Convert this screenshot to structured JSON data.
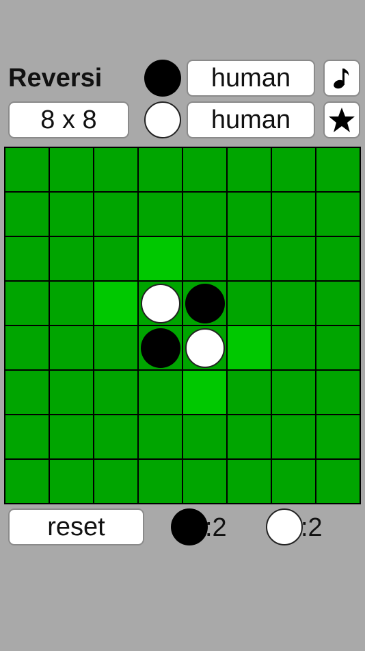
{
  "app": {
    "title": "Reversi"
  },
  "size_button": {
    "label": "8 x 8"
  },
  "players": {
    "black": {
      "label": "human"
    },
    "white": {
      "label": "human"
    }
  },
  "icons": {
    "music": "music-note-icon",
    "favorite": "star-icon"
  },
  "colors": {
    "background": "#a9a9a9",
    "board": "#00a500",
    "legal_move_highlight": "#00c800",
    "grid_lines": "#000000"
  },
  "board": {
    "size": 8,
    "cells": [
      [
        "",
        "",
        "",
        "",
        "",
        "",
        "",
        ""
      ],
      [
        "",
        "",
        "",
        "",
        "",
        "",
        "",
        ""
      ],
      [
        "",
        "",
        "",
        "h",
        "",
        "",
        "",
        ""
      ],
      [
        "",
        "",
        "h",
        "W",
        "B",
        "",
        "",
        ""
      ],
      [
        "",
        "",
        "",
        "B",
        "W",
        "h",
        "",
        ""
      ],
      [
        "",
        "",
        "",
        "",
        "h",
        "",
        "",
        ""
      ],
      [
        "",
        "",
        "",
        "",
        "",
        "",
        "",
        ""
      ],
      [
        "",
        "",
        "",
        "",
        "",
        "",
        "",
        ""
      ]
    ]
  },
  "controls": {
    "reset_label": "reset"
  },
  "score": {
    "black": ":2",
    "white": ":2"
  }
}
